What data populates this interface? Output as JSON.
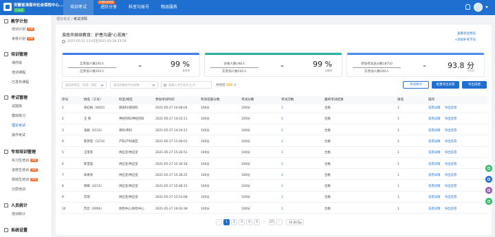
{
  "header": {
    "system_name": "安徽省淮南市社会保险中心...",
    "system_badge": "已认证",
    "nav": [
      "培训考试",
      "进阶分享",
      "科室与账号",
      "物品服务"
    ],
    "nav_badge": "不限年度考核",
    "colors": {
      "primary": "#1f6fd1",
      "badge": "#f36b2b"
    }
  },
  "sidebar": {
    "groups": [
      {
        "label": "教学计划",
        "items": [
          {
            "label": "培训计划",
            "badge": "待审"
          },
          {
            "label": "考核计划",
            "badge": "待审"
          }
        ]
      },
      {
        "label": "培训管理",
        "items": [
          {
            "label": "课件库"
          },
          {
            "label": "培训课程"
          },
          {
            "label": "已发布课程"
          }
        ]
      },
      {
        "label": "考试管理",
        "items": [
          {
            "label": "试题库"
          },
          {
            "label": "模拟练习"
          },
          {
            "label": "理论考试"
          },
          {
            "label": "操作考试"
          }
        ]
      },
      {
        "label": "专项培训管理",
        "items": [
          {
            "label": "实习生培训",
            "badge": "待审"
          },
          {
            "label": "进修生培训",
            "badge": "待审"
          },
          {
            "label": "规培生培训",
            "badge": "待审"
          },
          {
            "label": "分层培训"
          }
        ]
      },
      {
        "label": "人员统计",
        "items": [
          {
            "label": "培训统计"
          }
        ]
      },
      {
        "label": "系统设置",
        "items": []
      }
    ]
  },
  "breadcrumb": {
    "parent": "理论考试",
    "sep": "/",
    "current": "考试详情"
  },
  "exam": {
    "title": "淮南市继续教育：护患沟通\"心视角\"",
    "time": "2021-05-27 13:02至2021-05-28 23:59",
    "link1": "查看考试预览",
    "link2": "+添加补考学员"
  },
  "stats": [
    {
      "line1": "实参加人数200人",
      "line2": "应参加人数202人",
      "eq": "=",
      "value": "99 %",
      "label": "参考率",
      "color": "#3f7ee8"
    },
    {
      "line1": "合格人数198人",
      "line2": "实参加人数202人",
      "eq": "=",
      "value": "99 %",
      "label": "合格率",
      "color": "#2bb3a0"
    },
    {
      "line1": "参加考试总分数18750",
      "line2": "实参加人数200人",
      "eq": "=",
      "value": "93.8 分",
      "label": "平均分",
      "color": "#4a8ff0"
    }
  ],
  "filters": {
    "dept_placeholder": "请选择院区、科室、病区",
    "result_placeholder": "请选择最终考试结果",
    "search_placeholder": "请输入考生姓名/工号",
    "total_label": "共找到",
    "total_count": "202",
    "total_unit": "人"
  },
  "buttons": {
    "stats": "考试统计",
    "export_all": "批量导出试卷",
    "export_score": "导出成绩"
  },
  "table": {
    "headers": [
      "序号",
      "姓名（工号）",
      "科室/病区",
      "参加考试时间",
      "有效答题分数",
      "考试分数",
      "考试次数",
      "最终考试结果",
      "排名",
      "操作"
    ],
    "rows": [
      {
        "no": "1",
        "name": "朱红梅（0605）",
        "dept": "感染科/感染科",
        "time": "2021-05-27 14:08:04",
        "valid": "100分",
        "score": "100分",
        "count": "1",
        "result": "合格",
        "rank": "1"
      },
      {
        "no": "2",
        "name": "王 燕",
        "dept": "神经内科/神经内科",
        "time": "2021-05-27 14:03:11",
        "valid": "100分",
        "score": "100分",
        "count": "1",
        "result": "合格",
        "rank": "1"
      },
      {
        "no": "3",
        "name": "张娟（0113）",
        "dept": "骨科/骨科",
        "time": "2021-05-27 14:24:11",
        "valid": "100分",
        "score": "100分",
        "count": "1",
        "result": "合格",
        "rank": "1"
      },
      {
        "no": "4",
        "name": "陈梦莲（1274）",
        "dept": "产科/产科病区",
        "time": "2021-05-27 15:00:01",
        "valid": "100分",
        "score": "100分",
        "count": "1",
        "result": "合格",
        "rank": "1"
      },
      {
        "no": "5",
        "name": "王雪菲",
        "dept": "供应室/供应室",
        "time": "2021-05-27 15:26:51",
        "valid": "100分",
        "score": "100分",
        "count": "1",
        "result": "合格",
        "rank": "1"
      },
      {
        "no": "6",
        "name": "陈雪霞",
        "dept": "供应室/供应室",
        "time": "2021-05-27 15:30:18",
        "valid": "100分",
        "score": "100分",
        "count": "1",
        "result": "合格",
        "rank": "1"
      },
      {
        "no": "7",
        "name": "朱青青",
        "dept": "供应室/供应室",
        "time": "2021-05-27 15:36:25",
        "valid": "100分",
        "score": "100分",
        "count": "1",
        "result": "合格",
        "rank": "1"
      },
      {
        "no": "8",
        "name": "郭峰（0215）",
        "dept": "供应室/供应室",
        "time": "2021-05-27 15:48:15",
        "valid": "100分",
        "score": "100分",
        "count": "1",
        "result": "合格",
        "rank": "1"
      },
      {
        "no": "9",
        "name": "苏瑶",
        "dept": "供应室/供应室",
        "time": "2021-05-27 15:53:08",
        "valid": "100分",
        "score": "100分",
        "count": "1",
        "result": "合格",
        "rank": "1"
      },
      {
        "no": "10",
        "name": "苏云（0956）",
        "dept": "体检中心/体检中心",
        "time": "2021-05-27 16:03:38",
        "valid": "100分",
        "score": "100分",
        "count": "1",
        "result": "合格",
        "rank": "1"
      }
    ],
    "action_detail": "答卷详情",
    "action_export": "导出答卷"
  },
  "pagination": {
    "prev": "‹",
    "pages": [
      "1",
      "2",
      "3",
      "4",
      "5",
      "…",
      "21"
    ],
    "next": "›",
    "size": "10 条/页"
  },
  "floating_colors": [
    "#2bbf6a",
    "#1f6fd1",
    "#9b59b6",
    "#2bbf6a"
  ]
}
